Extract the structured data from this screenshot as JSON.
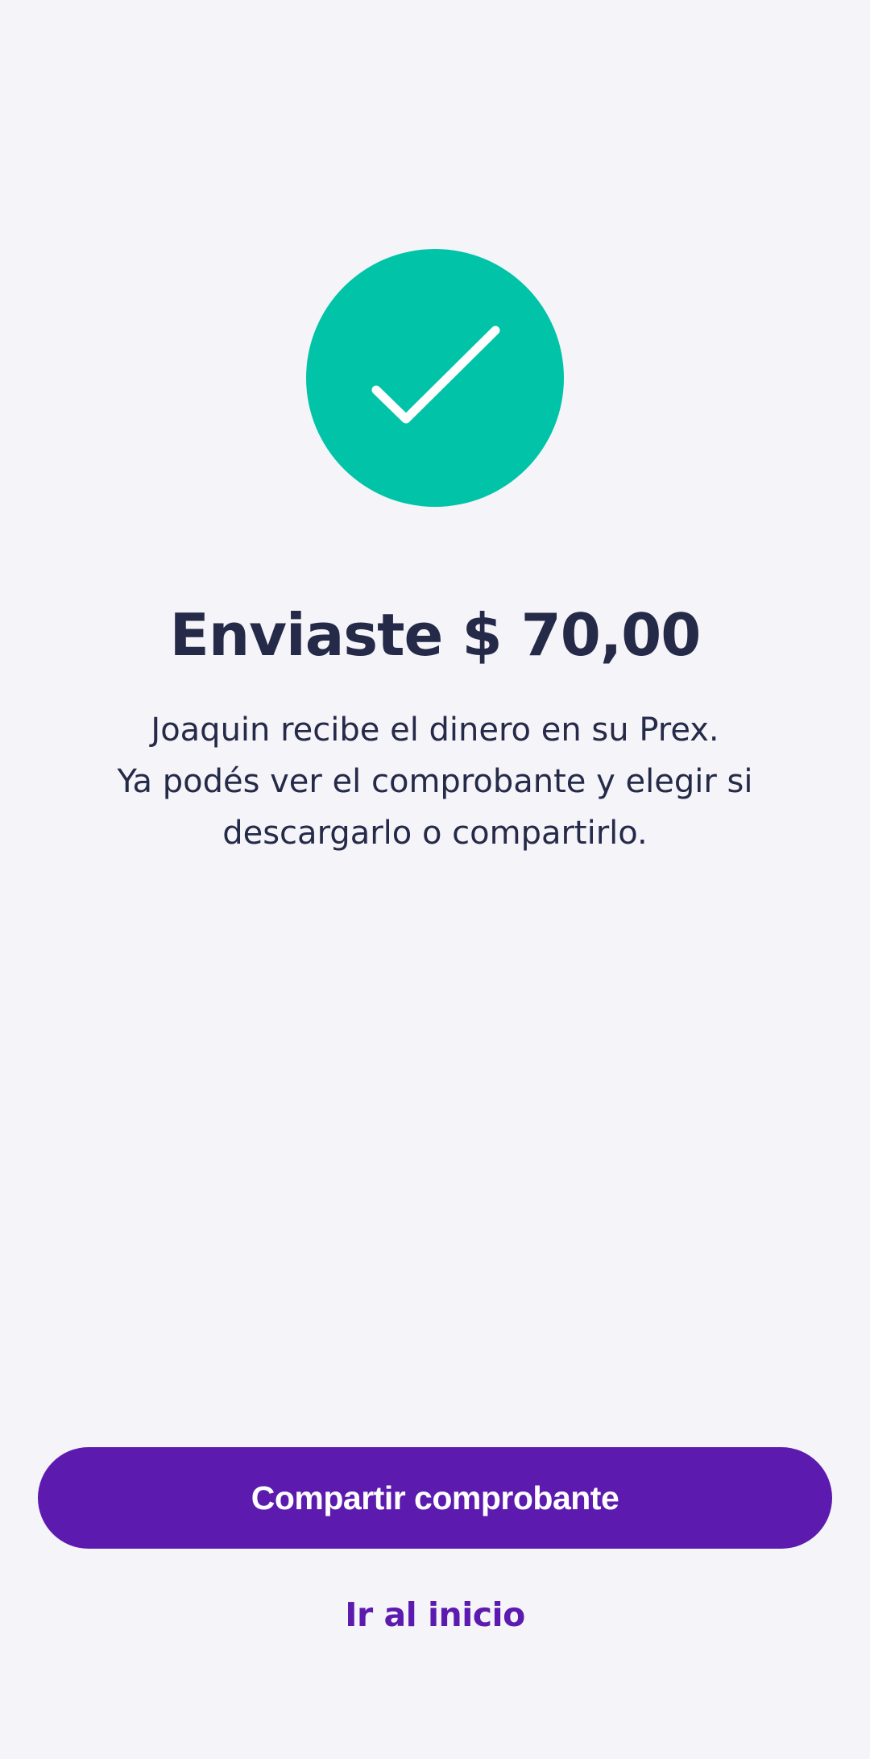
{
  "status": {
    "icon": "checkmark-icon",
    "color": "#00C3A8"
  },
  "title": "Enviaste $ 70,00",
  "message": {
    "line1": "Joaquin recibe el dinero en su Prex.",
    "line2": "Ya podés ver el comprobante y elegir si",
    "line3": "descargarlo o compartirlo."
  },
  "actions": {
    "share_label": "Compartir comprobante",
    "home_label": "Ir al inicio"
  },
  "colors": {
    "background": "#F4F4F9",
    "primary": "#5C1AAE",
    "text": "#252A48",
    "success": "#00C3A8"
  }
}
